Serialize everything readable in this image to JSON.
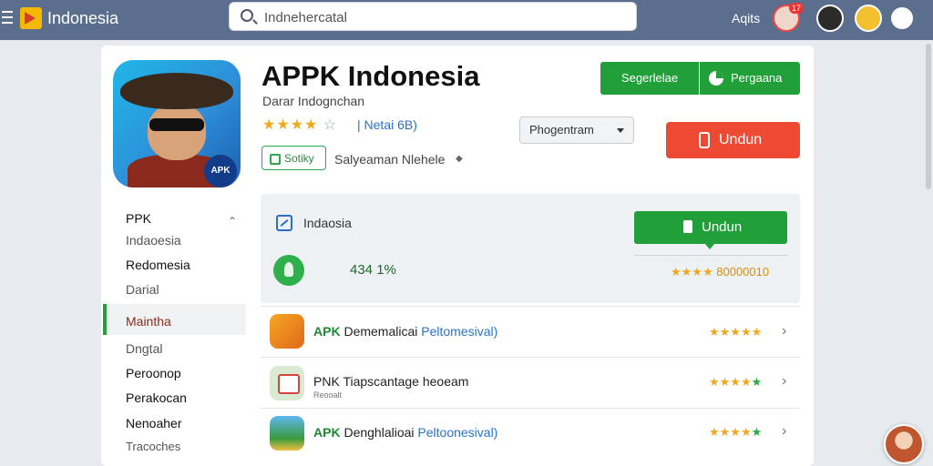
{
  "topbar": {
    "brand": "Indonesia",
    "search_placeholder": "Indnehercatal",
    "link": "Aqits",
    "notification_count": "17"
  },
  "app": {
    "title": "APPK Indonesia",
    "subtitle": "Darar Indognchan",
    "rating_stars": "★★★★",
    "rating_empty": "☆",
    "rating_text": "| Netai 6B)",
    "tag": "Sotiky",
    "developer": "Salyeaman Nlehele",
    "icon_badge": "APK"
  },
  "actions": {
    "green_left": "Segerlelae",
    "green_right": "Pergaana",
    "select_value": "Phogentram",
    "red_button": "Undun"
  },
  "sidebar": {
    "items": [
      {
        "label": "PPK"
      },
      {
        "label": "Indaoesia"
      },
      {
        "label": "Redomesia"
      },
      {
        "label": "Darial"
      },
      {
        "label": "Maintha"
      },
      {
        "label": "Dngtal"
      },
      {
        "label": "Peroonop"
      },
      {
        "label": "Perakocan"
      },
      {
        "label": "Nenoaher"
      },
      {
        "label": "Tracoches"
      }
    ]
  },
  "panel": {
    "title": "Indaosia",
    "stat": "434   1%",
    "download_button": "Undun",
    "rating_stars": "★★★★",
    "rating_value": "80000010"
  },
  "list": [
    {
      "prefix": "APK",
      "middle": "Dememalicai",
      "suffix": "Peltomesival)",
      "stars": "★★★★",
      "star_extra": "★",
      "subtitle": ""
    },
    {
      "prefix": "PNK",
      "middle": "Tiapscantage heoeam",
      "suffix": "",
      "stars": "★★★★",
      "star_extra": "★",
      "subtitle": "Reooalt"
    },
    {
      "prefix": "APK",
      "middle": "Denghlalioai",
      "suffix": "Peltoonesival)",
      "stars": "★★★★",
      "star_extra": "★",
      "subtitle": ""
    }
  ],
  "colors": {
    "topbar": "#5b6e8d",
    "green": "#21a03a",
    "red": "#ee4a33",
    "star": "#f0a81c",
    "link_blue": "#2a72c8"
  }
}
